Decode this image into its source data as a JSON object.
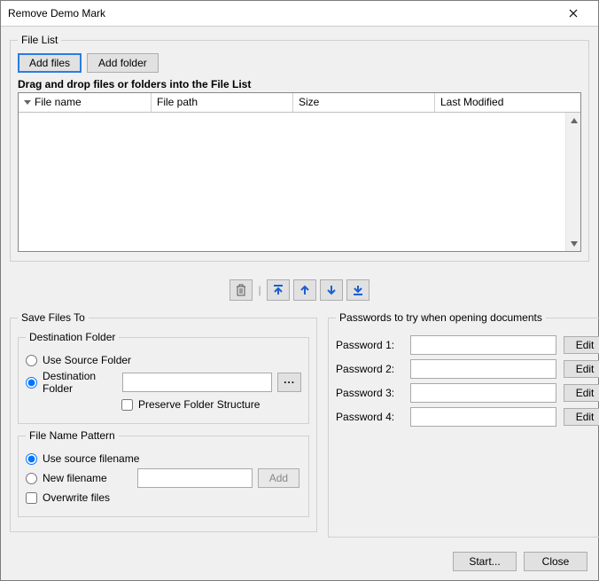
{
  "window": {
    "title": "Remove Demo Mark"
  },
  "fileList": {
    "legend": "File List",
    "addFiles": "Add files",
    "addFolder": "Add folder",
    "hint": "Drag and drop files or folders into the File List",
    "columns": {
      "fileName": "File name",
      "filePath": "File path",
      "size": "Size",
      "lastModified": "Last Modified"
    },
    "rows": []
  },
  "iconBar": {
    "delete": "delete-icon",
    "moveTop": "move-top-icon",
    "moveUp": "move-up-icon",
    "moveDown": "move-down-icon",
    "moveBottom": "move-bottom-icon"
  },
  "saveTo": {
    "legend": "Save Files To",
    "destLegend": "Destination Folder",
    "useSource": "Use Source Folder",
    "destFolder": "Destination Folder",
    "destPath": "",
    "browse": "...",
    "preserve": "Preserve Folder Structure",
    "patternLegend": "File Name Pattern",
    "useSourceFilename": "Use source filename",
    "newFilename": "New filename",
    "newFilenameValue": "",
    "addBtn": "Add",
    "overwrite": "Overwrite files"
  },
  "passwords": {
    "legend": "Passwords to try when opening documents",
    "rows": [
      {
        "label": "Password 1:",
        "value": "",
        "edit": "Edit"
      },
      {
        "label": "Password 2:",
        "value": "",
        "edit": "Edit"
      },
      {
        "label": "Password 3:",
        "value": "",
        "edit": "Edit"
      },
      {
        "label": "Password 4:",
        "value": "",
        "edit": "Edit"
      }
    ]
  },
  "footer": {
    "start": "Start...",
    "close": "Close"
  }
}
